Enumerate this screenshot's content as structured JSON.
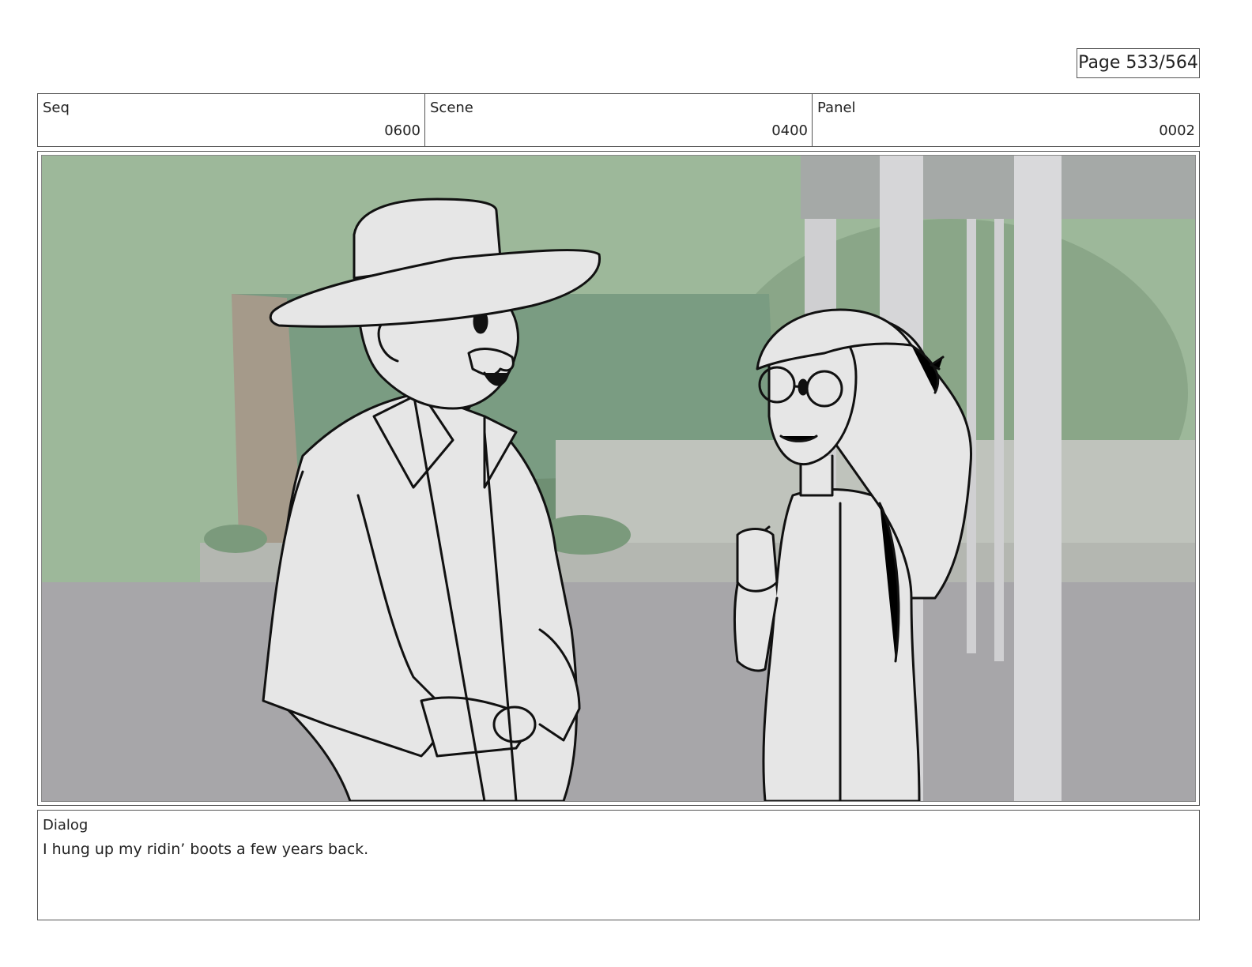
{
  "page": {
    "number_text": "Page 533/564"
  },
  "header": {
    "seq": {
      "label": "Seq",
      "value": "0600"
    },
    "scene": {
      "label": "Scene",
      "value": "0400"
    },
    "panel": {
      "label": "Panel",
      "value": "0002"
    }
  },
  "dialog": {
    "label": "Dialog",
    "text": "I hung up my ridin’ boots a few years back."
  },
  "colors": {
    "sky": "#9db89a",
    "ground": "#a7a6a9",
    "sketch_fill": "#e6e6e6",
    "line": "#111111"
  }
}
